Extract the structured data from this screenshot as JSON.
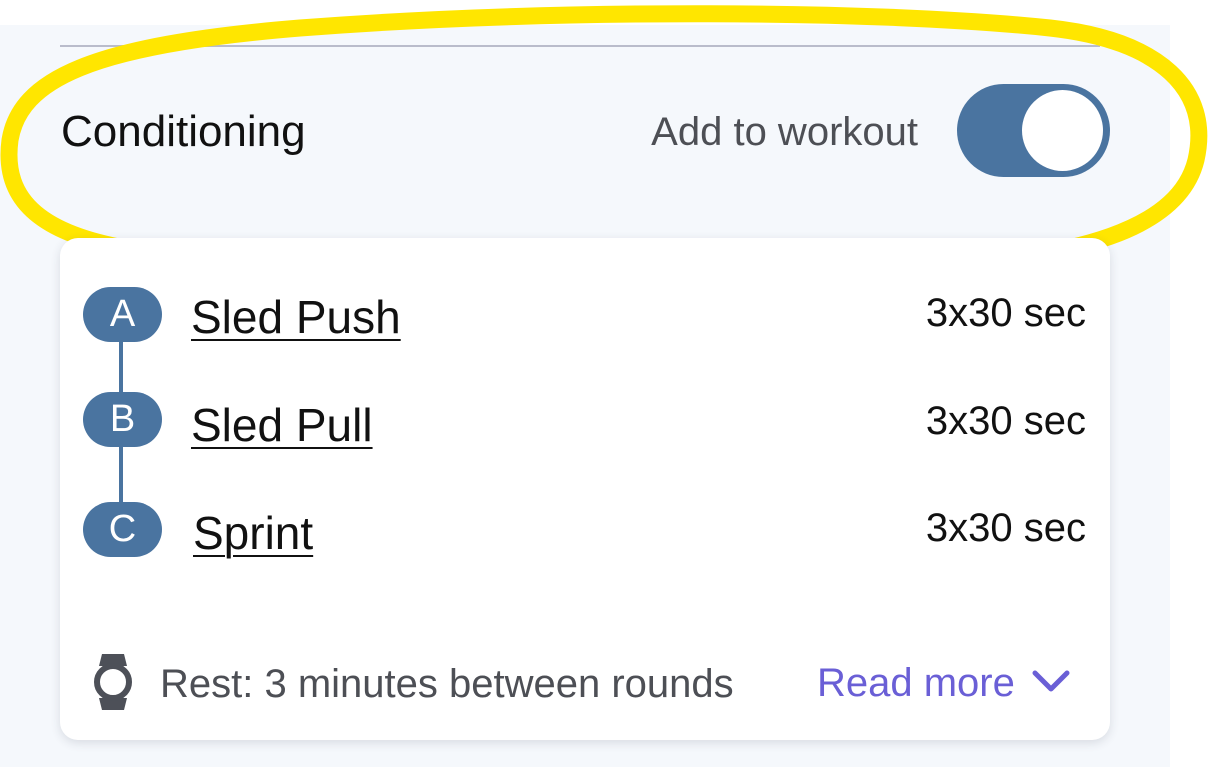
{
  "section": {
    "title": "Conditioning",
    "toggle_label": "Add to workout",
    "toggle_on": true
  },
  "exercises": [
    {
      "letter": "A",
      "name": "Sled Push",
      "sets": "3x30 sec"
    },
    {
      "letter": "B",
      "name": "Sled Pull",
      "sets": "3x30 sec"
    },
    {
      "letter": "C",
      "name": "Sprint",
      "sets": "3x30 sec"
    }
  ],
  "footer": {
    "rest_text": "Rest: 3 minutes between rounds",
    "read_more": "Read more"
  },
  "colors": {
    "accent_blue": "#4a74a0",
    "link_purple": "#6a5fd6",
    "highlight_yellow": "#ffe600",
    "panel_bg": "#f5f8fc"
  },
  "icons": [
    "watch-icon",
    "chevron-down-icon"
  ]
}
